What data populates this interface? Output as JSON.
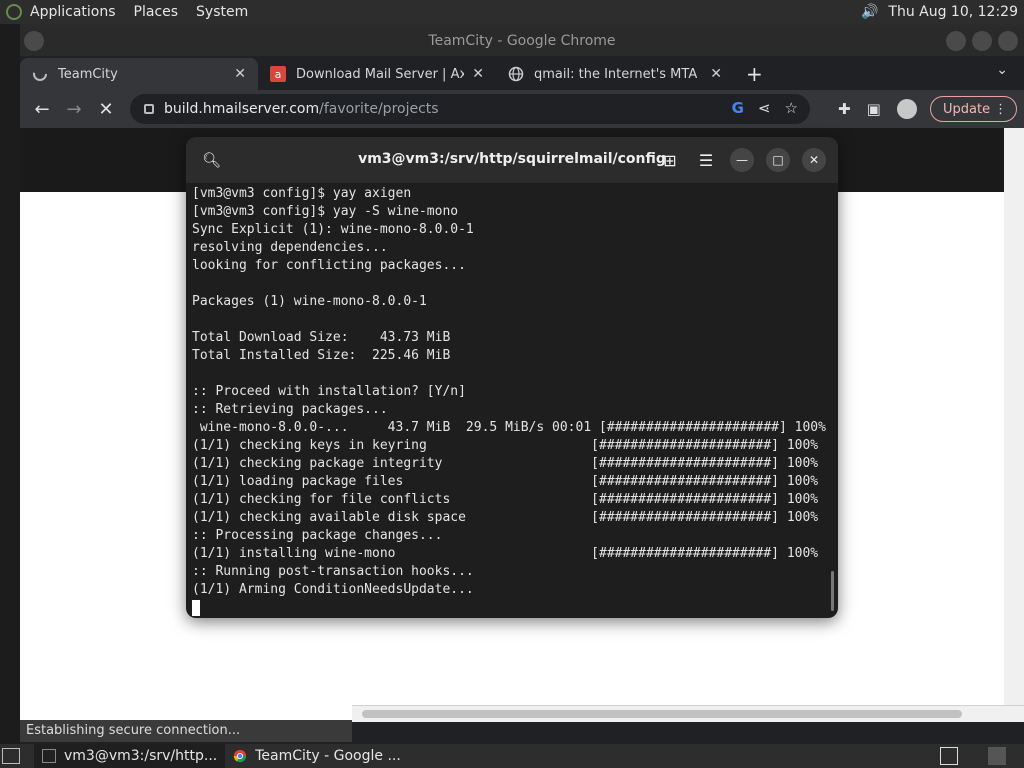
{
  "top_panel": {
    "menus": [
      "Applications",
      "Places",
      "System"
    ],
    "clock": "Thu Aug 10, 12:29"
  },
  "browser": {
    "window_title": "TeamCity - Google Chrome",
    "tabs": [
      {
        "label": "TeamCity",
        "icon": "loading-spinner-icon"
      },
      {
        "label": "Download Mail Server | Axigen",
        "icon": "axigen-favicon-icon"
      },
      {
        "label": "qmail: the Internet's MTA of ch",
        "icon": "globe-icon"
      }
    ],
    "url_host": "build.hmailserver.com",
    "url_path": "/favorite/projects",
    "update_label": "Update",
    "status_text": "Establishing secure connection..."
  },
  "terminal": {
    "title": "vm3@vm3:/srv/http/squirrelmail/config",
    "lines": [
      "[vm3@vm3 config]$ yay axigen",
      "[vm3@vm3 config]$ yay -S wine-mono",
      "Sync Explicit (1): wine-mono-8.0.0-1",
      "resolving dependencies...",
      "looking for conflicting packages...",
      "",
      "Packages (1) wine-mono-8.0.0-1",
      "",
      "Total Download Size:    43.73 MiB",
      "Total Installed Size:  225.46 MiB",
      "",
      ":: Proceed with installation? [Y/n]",
      ":: Retrieving packages...",
      " wine-mono-8.0.0-...     43.7 MiB  29.5 MiB/s 00:01 [######################] 100%",
      "(1/1) checking keys in keyring                     [######################] 100%",
      "(1/1) checking package integrity                   [######################] 100%",
      "(1/1) loading package files                        [######################] 100%",
      "(1/1) checking for file conflicts                  [######################] 100%",
      "(1/1) checking available disk space                [######################] 100%",
      ":: Processing package changes...",
      "(1/1) installing wine-mono                         [######################] 100%",
      ":: Running post-transaction hooks...",
      "(1/1) Arming ConditionNeedsUpdate..."
    ]
  },
  "taskbar": {
    "items": [
      {
        "label": "vm3@vm3:/srv/http...",
        "icon": "terminal-icon"
      },
      {
        "label": "TeamCity - Google ...",
        "icon": "chrome-icon"
      }
    ]
  }
}
